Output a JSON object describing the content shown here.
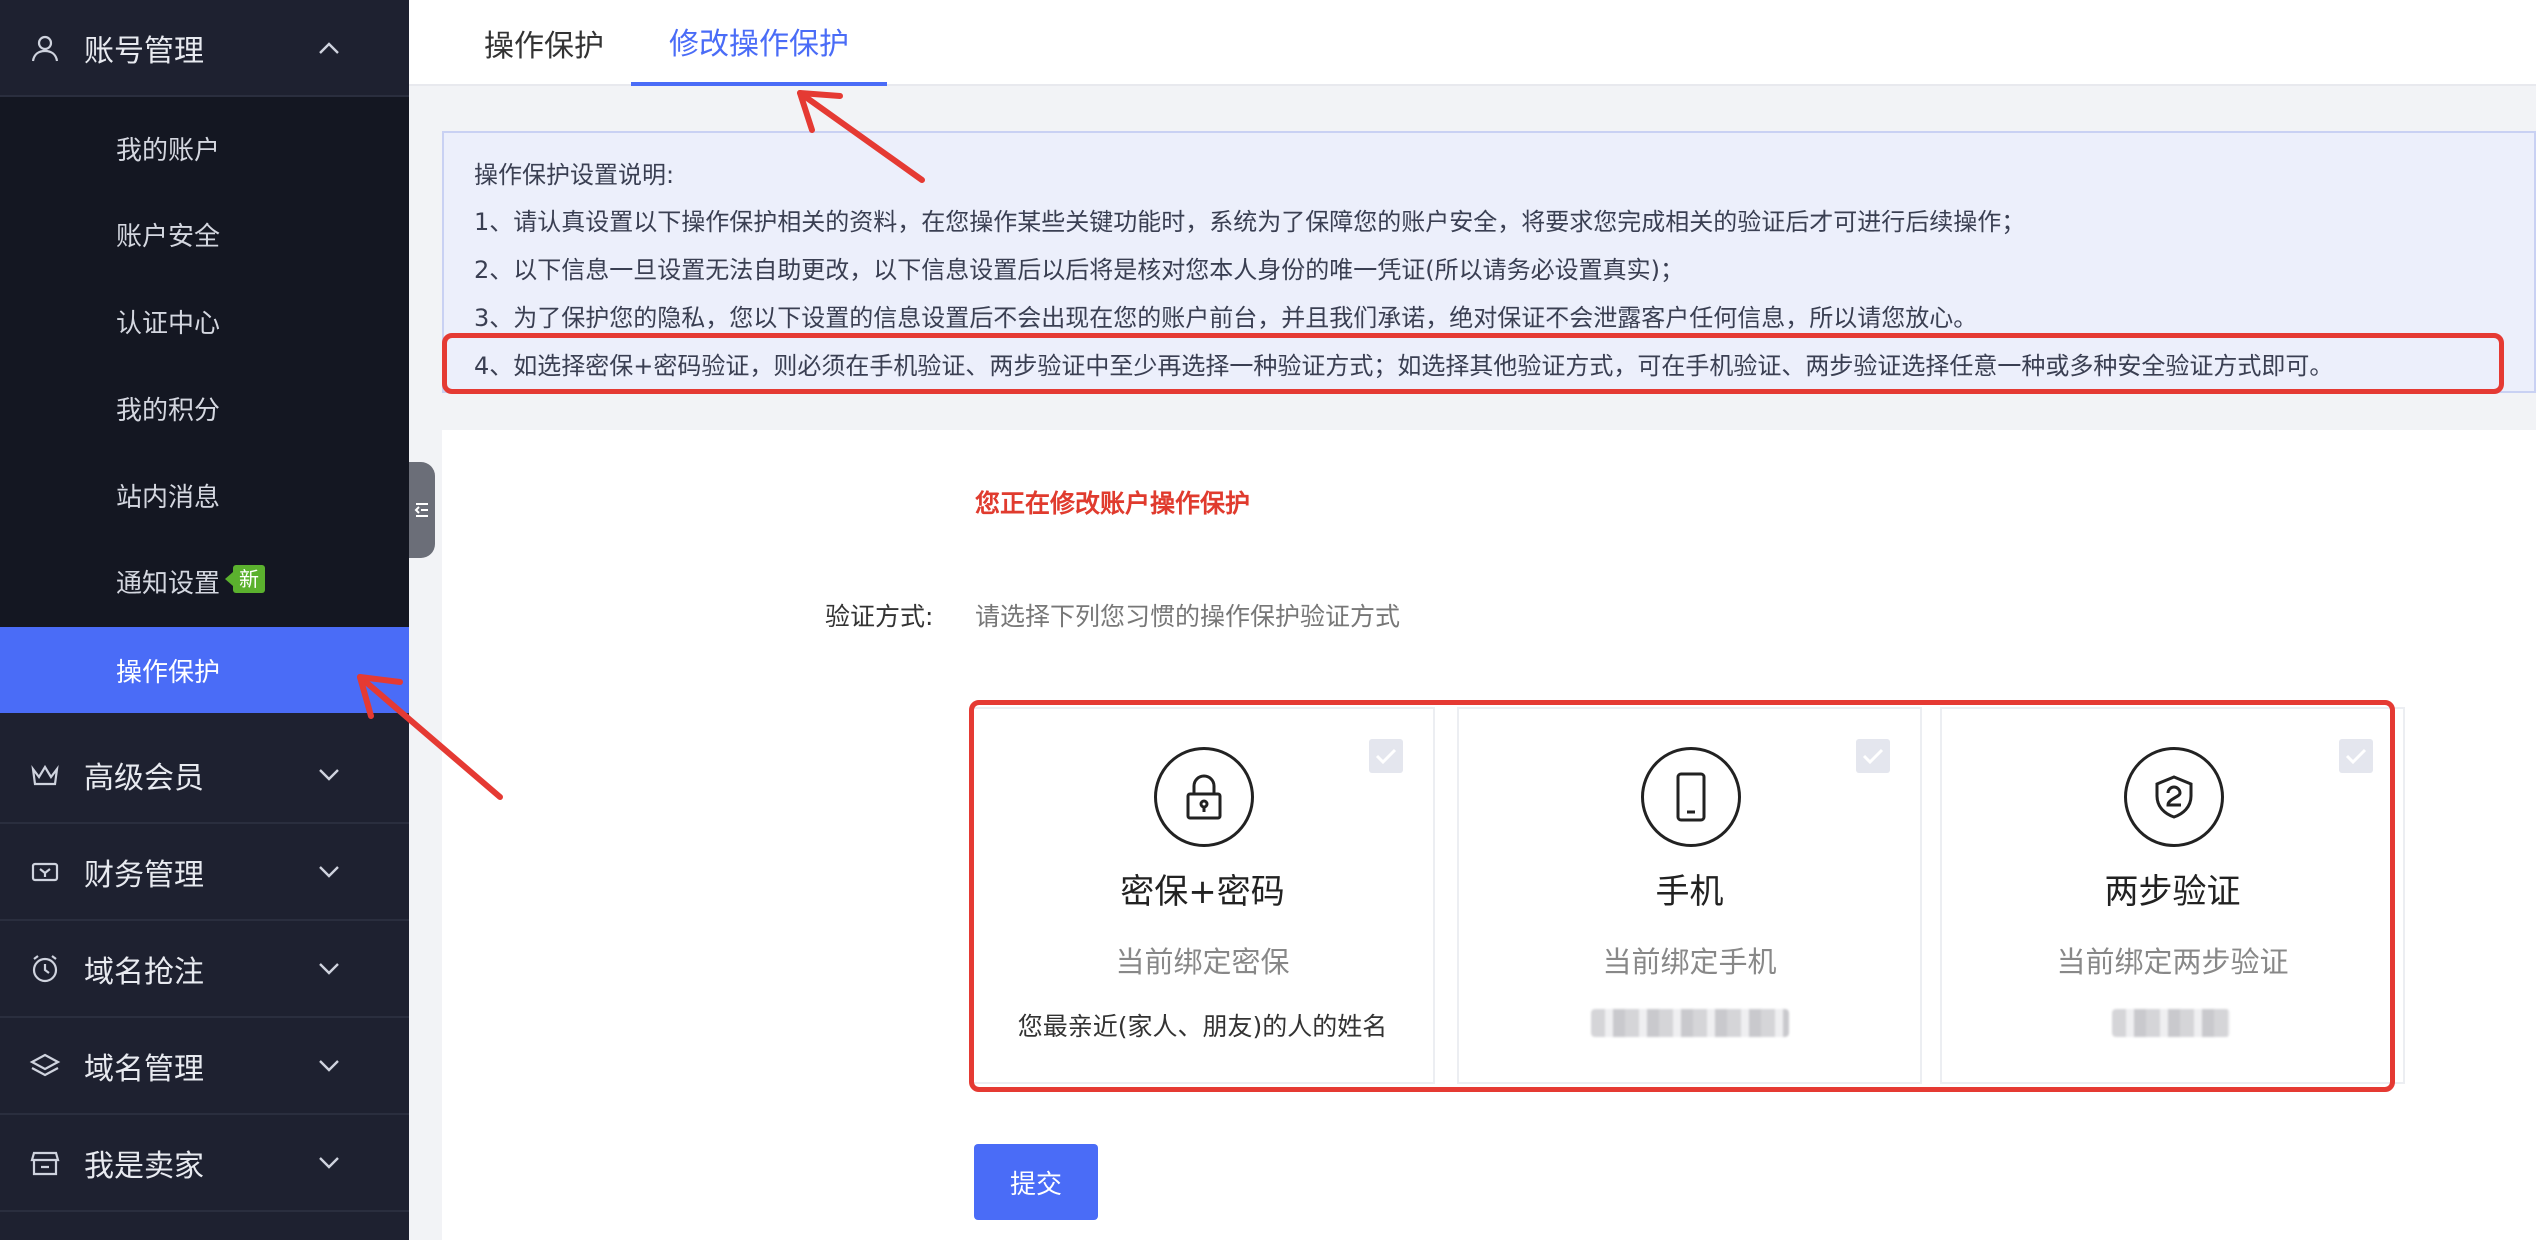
{
  "sidebar": {
    "account_group": "账号管理",
    "sub_items": [
      "我的账户",
      "账户安全",
      "认证中心",
      "我的积分",
      "站内消息",
      "通知设置",
      "操作保护"
    ],
    "new_badge": "新",
    "groups": [
      "高级会员",
      "财务管理",
      "域名抢注",
      "域名管理",
      "我是卖家"
    ]
  },
  "tabs": [
    "操作保护",
    "修改操作保护"
  ],
  "notice": {
    "heading": "操作保护设置说明:",
    "lines": [
      "1、请认真设置以下操作保护相关的资料，在您操作某些关键功能时，系统为了保障您的账户安全，将要求您完成相关的验证后才可进行后续操作；",
      "2、以下信息一旦设置无法自助更改，以下信息设置后以后将是核对您本人身份的唯一凭证(所以请务必设置真实)；",
      "3、为了保护您的隐私，您以下设置的信息设置后不会出现在您的账户前台，并且我们承诺，绝对保证不会泄露客户任何信息，所以请您放心。",
      "4、如选择密保+密码验证，则必须在手机验证、两步验证中至少再选择一种验证方式；如选择其他验证方式，可在手机验证、两步验证选择任意一种或多种安全验证方式即可。"
    ]
  },
  "form": {
    "status_title": "您正在修改账户操作保护",
    "method_label": "验证方式:",
    "method_hint": "请选择下列您习惯的操作保护验证方式"
  },
  "cards": [
    {
      "icon": "lock-icon",
      "title": "密保+密码",
      "subtitle": "当前绑定密保",
      "value": "您最亲近(家人、朋友)的人的姓名"
    },
    {
      "icon": "phone-icon",
      "title": "手机",
      "subtitle": "当前绑定手机",
      "value": ""
    },
    {
      "icon": "shield-icon",
      "title": "两步验证",
      "subtitle": "当前绑定两步验证",
      "value": ""
    }
  ],
  "submit_label": "提交",
  "colors": {
    "accent": "#4a6cf7",
    "sidebar": "#1e2130",
    "alert": "#e53a33",
    "badge": "#5bb12e"
  }
}
